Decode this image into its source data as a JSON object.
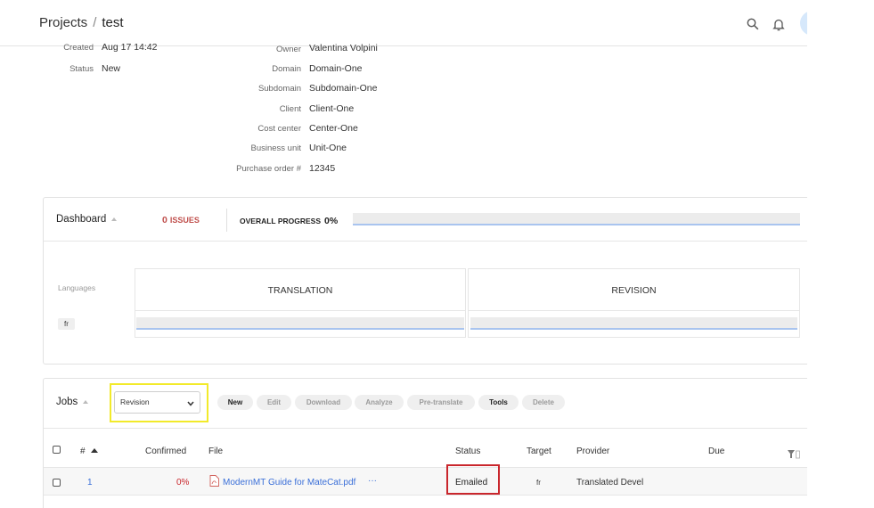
{
  "header": {
    "breadcrumb_root": "Projects",
    "breadcrumb_sep": "/",
    "breadcrumb_current": "test",
    "icons": [
      "search-icon",
      "bell-icon"
    ]
  },
  "details": {
    "created": {
      "label": "Created",
      "value": "Aug 17 14:42"
    },
    "status": {
      "label": "Status",
      "value": "New"
    },
    "owner": {
      "label": "Owner",
      "value": "Valentina Volpini"
    },
    "domain": {
      "label": "Domain",
      "value": "Domain-One"
    },
    "subdomain": {
      "label": "Subdomain",
      "value": "Subdomain-One"
    },
    "client": {
      "label": "Client",
      "value": "Client-One"
    },
    "cost_center": {
      "label": "Cost center",
      "value": "Center-One"
    },
    "business_unit": {
      "label": "Business unit",
      "value": "Unit-One"
    },
    "purchase_order": {
      "label": "Purchase order #",
      "value": "12345"
    }
  },
  "dashboard": {
    "title": "Dashboard",
    "issues_count": "0",
    "issues_label": "ISSUES",
    "overall_label": "OVERALL PROGRESS",
    "overall_value": "0%",
    "languages_label": "Languages",
    "language": "fr",
    "translation_label": "TRANSLATION",
    "revision_label": "REVISION"
  },
  "jobs": {
    "title": "Jobs",
    "select_value": "Revision",
    "buttons": {
      "new": "New",
      "edit": "Edit",
      "download": "Download",
      "analyze": "Analyze",
      "pretranslate": "Pre-translate",
      "tools": "Tools",
      "delete": "Delete"
    },
    "columns": {
      "num": "#",
      "confirmed": "Confirmed",
      "file": "File",
      "status": "Status",
      "target": "Target",
      "provider": "Provider",
      "due": "Due"
    },
    "rows": [
      {
        "num": "1",
        "confirmed": "0%",
        "file": "ModernMT Guide for MateCat.pdf",
        "more": "···",
        "status": "Emailed",
        "target": "fr",
        "provider": "Translated Devel",
        "due": ""
      }
    ]
  },
  "colors": {
    "accent_link": "#3a6fd8",
    "issues_red": "#c0504d",
    "highlight_yellow": "#f2ea2a",
    "highlight_red": "#c9262c",
    "progress_line": "#a9c4ef"
  }
}
